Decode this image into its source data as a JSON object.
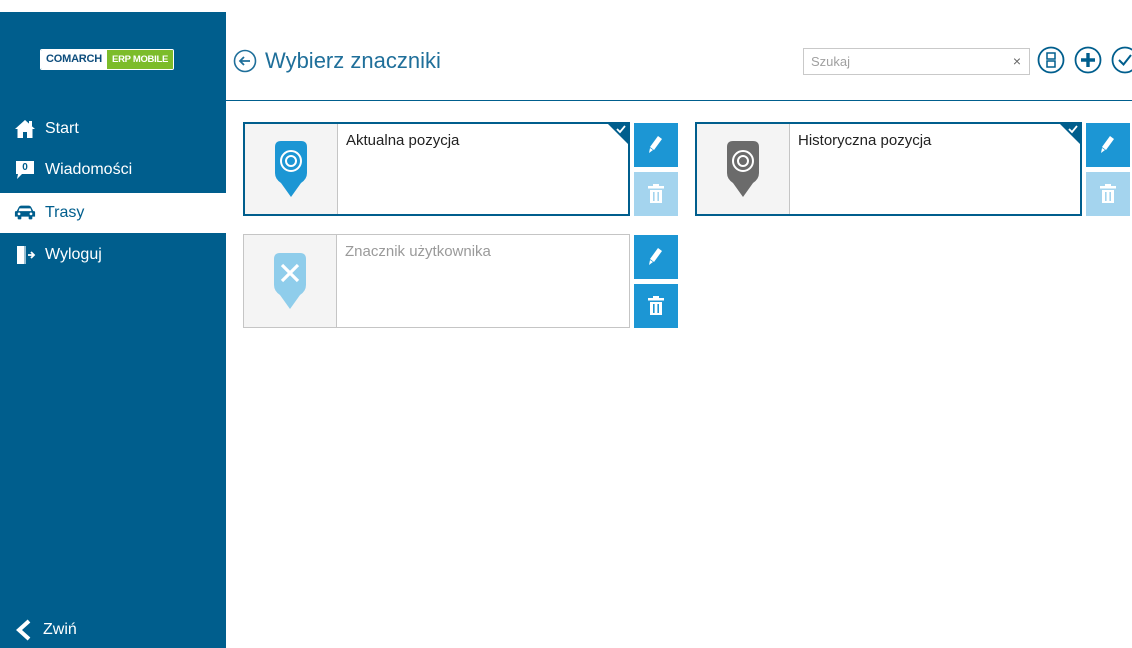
{
  "logo": {
    "part1": "COMARCH",
    "part2": "ERP MOBILE"
  },
  "sidebar": {
    "items": [
      {
        "label": "Start",
        "icon": "home-icon"
      },
      {
        "label": "Wiadomości",
        "icon": "message-icon",
        "badge": "0"
      },
      {
        "label": "Trasy",
        "icon": "car-icon",
        "active": true
      },
      {
        "label": "Wyloguj",
        "icon": "logout-icon"
      }
    ],
    "collapse_label": "Zwiń"
  },
  "header": {
    "title": "Wybierz znaczniki",
    "search_placeholder": "Szukaj",
    "search_clear": "×"
  },
  "cards": [
    {
      "title": "Aktualna pozycja",
      "selected": true,
      "marker_color": "#1c96d4",
      "delete_enabled": false
    },
    {
      "title": "Historyczna pozycja",
      "selected": true,
      "marker_color": "#6b6b6b",
      "delete_enabled": false
    },
    {
      "title": "Znacznik użytkownika",
      "selected": false,
      "marker_color": "#8fcdeb",
      "delete_enabled": true
    }
  ],
  "colors": {
    "sidebar": "#005e8d",
    "accent": "#1c96d4",
    "disabled": "#a4d4ee"
  }
}
